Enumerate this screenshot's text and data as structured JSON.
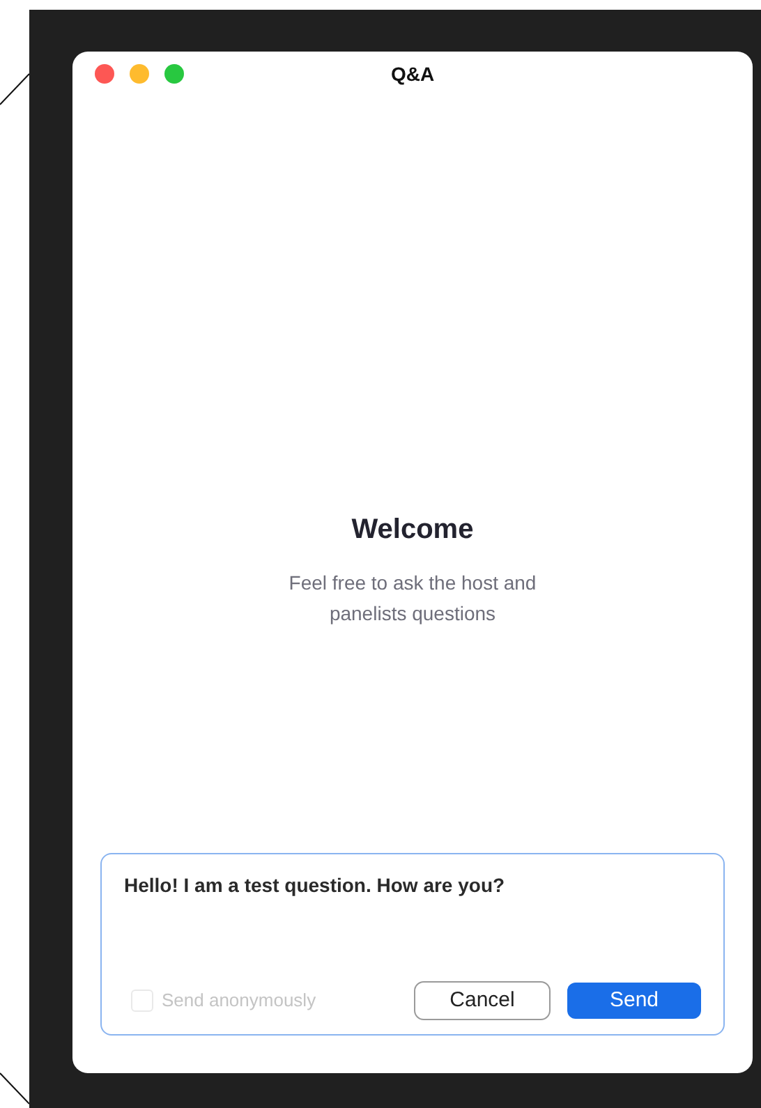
{
  "window": {
    "title": "Q&A"
  },
  "welcome": {
    "heading": "Welcome",
    "text": "Feel free to ask the host and panelists questions"
  },
  "composer": {
    "value": "Hello! I am a test question. How are you?",
    "anonymous": {
      "label": "Send anonymously",
      "checked": false,
      "disabled": true
    },
    "buttons": [
      {
        "label": "Cancel",
        "kind": "secondary"
      },
      {
        "label": "Send",
        "kind": "primary"
      }
    ]
  }
}
